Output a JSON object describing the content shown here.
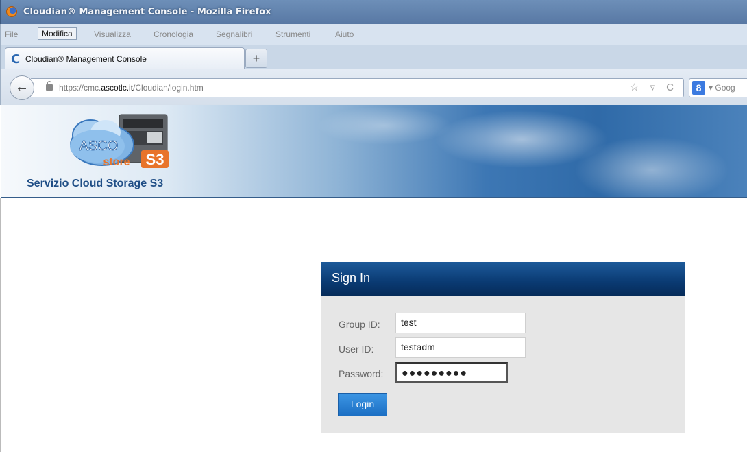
{
  "window": {
    "title": "Cloudian® Management Console - Mozilla Firefox"
  },
  "menu": {
    "items": [
      "File",
      "Modifica",
      "Visualizza",
      "Cronologia",
      "Segnalibri",
      "Strumenti",
      "Aiuto"
    ],
    "active": "Modifica"
  },
  "tab": {
    "title": "Cloudian® Management Console",
    "new_tab": "+"
  },
  "nav": {
    "back": "←",
    "url_prefix": "https://cmc.",
    "url_domain": "ascotlc.it",
    "url_path": "/Cloudian/login.htm",
    "url_icons": "☆ ▿ C",
    "search_placeholder": "Goog",
    "search_engine_glyph": "8",
    "search_dropdown": "▾"
  },
  "banner": {
    "logo_text_top": "ASCO",
    "logo_text_bottom": "store",
    "logo_badge": "S3",
    "title": "Servizio Cloud Storage S3"
  },
  "signin": {
    "heading": "Sign In",
    "group_label": "Group ID:",
    "group_value": "test",
    "user_label": "User ID:",
    "user_value": "testadm",
    "password_label": "Password:",
    "password_value": "●●●●●●●●●",
    "login_label": "Login"
  },
  "colors": {
    "signin_header": "#0a3a72",
    "login_button": "#2a80d4",
    "panel_background": "#e6e6e6",
    "banner_title": "#1f4e86"
  }
}
